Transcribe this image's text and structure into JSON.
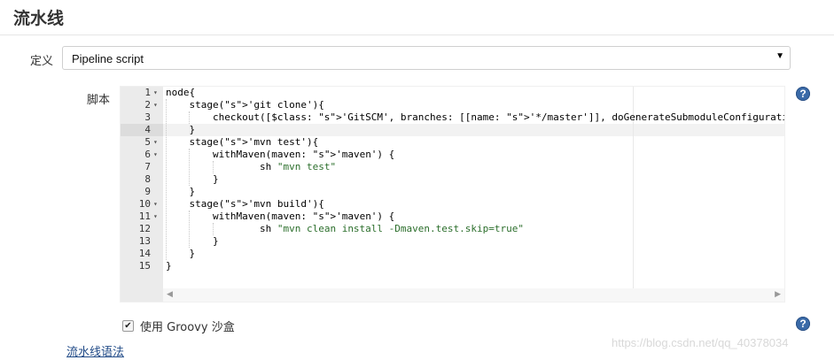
{
  "section": {
    "title": "流水线"
  },
  "definition": {
    "label": "定义",
    "selected": "Pipeline script",
    "arrow": "▼"
  },
  "script": {
    "label": "脚本",
    "lines": [
      {
        "num": "1",
        "fold": "▾",
        "code": "node{"
      },
      {
        "num": "2",
        "fold": "▾",
        "code": "    stage('git clone'){"
      },
      {
        "num": "3",
        "fold": "",
        "code": "        checkout([$class: 'GitSCM', branches: [[name: '*/master']], doGenerateSubmoduleConfigurations: fals"
      },
      {
        "num": "4",
        "fold": "",
        "code": "    }"
      },
      {
        "num": "5",
        "fold": "▾",
        "code": "    stage('mvn test'){"
      },
      {
        "num": "6",
        "fold": "▾",
        "code": "        withMaven(maven: 'maven') {"
      },
      {
        "num": "7",
        "fold": "",
        "code": "                sh \"mvn test\""
      },
      {
        "num": "8",
        "fold": "",
        "code": "        }"
      },
      {
        "num": "9",
        "fold": "",
        "code": "    }"
      },
      {
        "num": "10",
        "fold": "▾",
        "code": "    stage('mvn build'){"
      },
      {
        "num": "11",
        "fold": "▾",
        "code": "        withMaven(maven: 'maven') {"
      },
      {
        "num": "12",
        "fold": "",
        "code": "                sh \"mvn clean install -Dmaven.test.skip=true\""
      },
      {
        "num": "13",
        "fold": "",
        "code": "        }"
      },
      {
        "num": "14",
        "fold": "",
        "code": "    }"
      },
      {
        "num": "15",
        "fold": "",
        "code": "}"
      }
    ],
    "active_line": 4
  },
  "help_icon": "?",
  "sandbox": {
    "checked": true,
    "check_glyph": "✔",
    "label": "使用 Groovy 沙盒"
  },
  "syntax_link": "流水线语法",
  "watermark": "https://blog.csdn.net/qq_40378034",
  "scroll": {
    "left": "◀",
    "right": "▶"
  },
  "colors": {
    "link": "#204a87",
    "help": "#3a6aa8",
    "string": "#2b6e2b",
    "gutter": "#ebebeb"
  }
}
